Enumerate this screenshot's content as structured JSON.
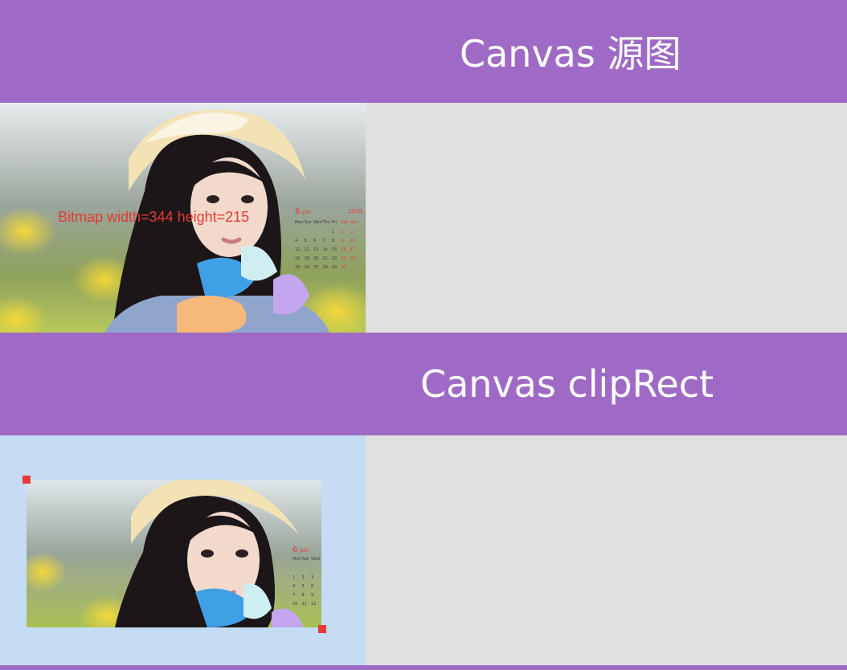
{
  "header1": {
    "title": "Canvas 源图"
  },
  "header2": {
    "title": "Canvas clipRect"
  },
  "bitmap_info": "Bitmap width=344 height=215",
  "calendar": {
    "year": "2018",
    "month": "Jun",
    "day": "6",
    "weekdays": [
      "Mon",
      "Tue",
      "Wed",
      "Thu",
      "Fri",
      "Sat",
      "Sun"
    ]
  },
  "colors": {
    "header_bg": "#9f6ac6",
    "panel_bg": "#e0e0e0",
    "clip_bg": "#c4ddf4",
    "label_red": "#e53935"
  }
}
